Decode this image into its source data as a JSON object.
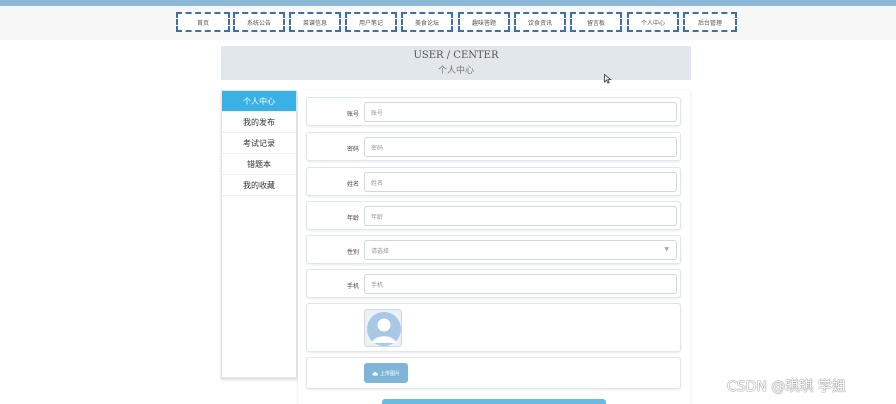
{
  "nav": {
    "items": [
      {
        "label": "首页"
      },
      {
        "label": "系统公告"
      },
      {
        "label": "菜谱信息"
      },
      {
        "label": "用户笔记"
      },
      {
        "label": "美食论坛"
      },
      {
        "label": "趣味答题"
      },
      {
        "label": "饮食资讯"
      },
      {
        "label": "留言板"
      },
      {
        "label": "个人中心"
      },
      {
        "label": "后台管理"
      }
    ]
  },
  "header": {
    "title_en": "USER / CENTER",
    "title_cn": "个人中心"
  },
  "sidebar": {
    "items": [
      {
        "label": "个人中心",
        "active": true
      },
      {
        "label": "我的发布"
      },
      {
        "label": "考试记录"
      },
      {
        "label": "错题本"
      },
      {
        "label": "我的收藏"
      }
    ]
  },
  "form": {
    "fields": [
      {
        "label": "账号",
        "placeholder": "账号"
      },
      {
        "label": "密码",
        "placeholder": "密码"
      },
      {
        "label": "姓名",
        "placeholder": "姓名"
      },
      {
        "label": "年龄",
        "placeholder": "年龄"
      },
      {
        "label": "性别",
        "placeholder": "请选择"
      },
      {
        "label": "手机",
        "placeholder": "手机"
      }
    ],
    "upload_label": "上传图片"
  },
  "watermark": "CSDN @琪琪 学姐",
  "colors": {
    "accent": "#3ab1e6",
    "nav_border": "#3f6fa8",
    "header_bg": "#e1e7ea",
    "upload_button": "#7fb6d8"
  },
  "icons": [
    "avatar-placeholder-icon",
    "cloud-upload-icon",
    "chevron-down-icon",
    "mouse-cursor-icon"
  ]
}
